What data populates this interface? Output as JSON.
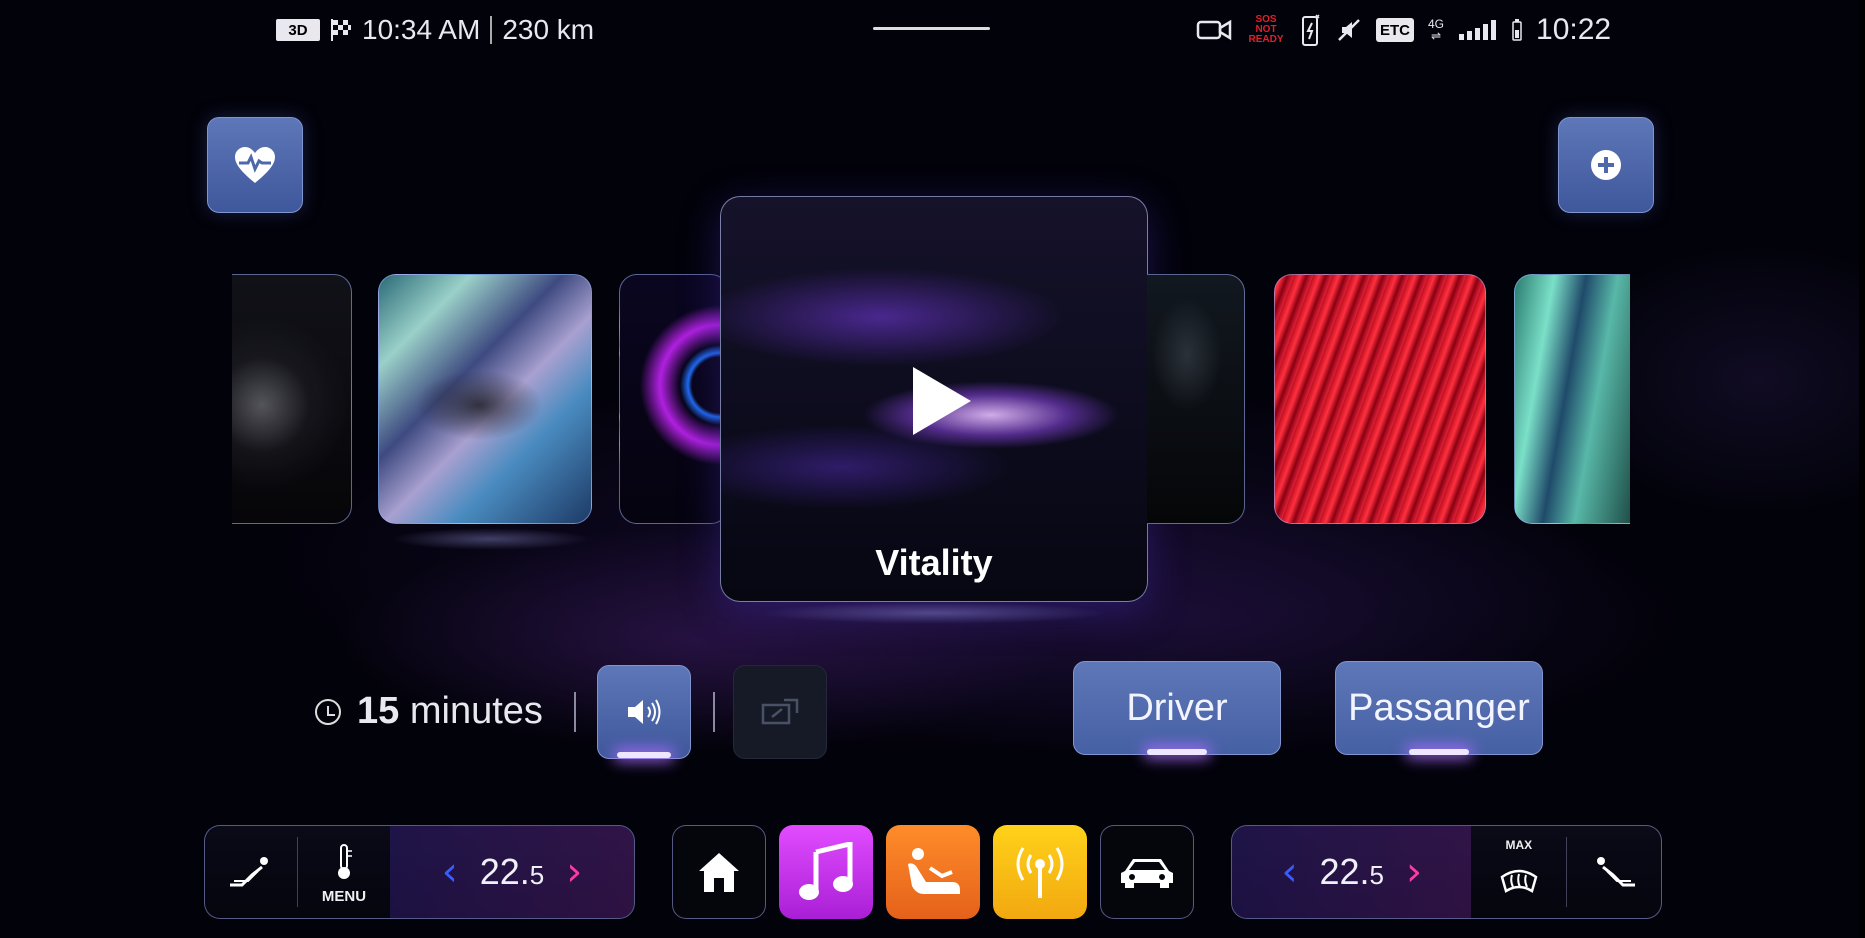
{
  "status_bar": {
    "nav_mode": "3D",
    "arrival_time": "10:34 AM",
    "distance": "230 km",
    "sos_line1": "SOS NOT",
    "sos_line2": "READY",
    "etc_label": "ETC",
    "network": "4G",
    "clock": "10:22",
    "icons": [
      "navigation-3d-icon",
      "checkered-flag-icon",
      "dashcam-icon",
      "phone-charging-icon",
      "mute-icon",
      "etc-badge",
      "signal-icon",
      "battery-icon"
    ]
  },
  "carousel": {
    "selected_title": "Vitality",
    "cards": [
      "dark-dandelion",
      "iridescent-crystal",
      "purple-swirl",
      "vitality",
      "dark-rain",
      "red-waves",
      "teal-glass"
    ]
  },
  "controls": {
    "duration_value": "15",
    "duration_unit": "minutes",
    "driver_label": "Driver",
    "passenger_label": "Passanger"
  },
  "climate": {
    "left_temp_int": "22.",
    "left_temp_dec": "5",
    "right_temp_int": "22.",
    "right_temp_dec": "5",
    "menu_label": "MENU",
    "defrost_label": "MAX"
  },
  "dock": {
    "apps": [
      "home",
      "music",
      "seat",
      "radio",
      "car"
    ]
  },
  "colors": {
    "accent_button": "#4f68ab",
    "chevron_left": "#3a5cff",
    "chevron_right": "#ff3aa8",
    "music_app": "#c535ee",
    "seat_app": "#f07522",
    "radio_app": "#f9bd15"
  }
}
